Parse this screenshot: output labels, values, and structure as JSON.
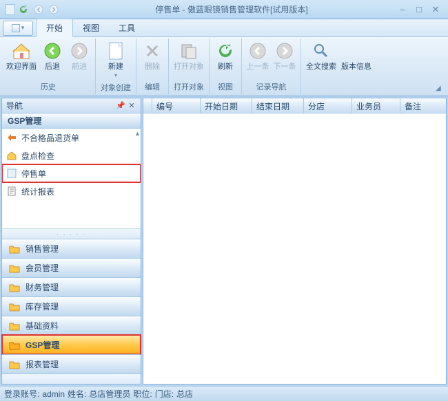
{
  "title": "停售单 - 傲蓝眼镜销售管理软件[试用版本]",
  "tabs": {
    "start": "开始",
    "view": "视图",
    "tools": "工具"
  },
  "ribbon": {
    "welcome": "欢迎界面",
    "back": "后退",
    "forward": "前进",
    "new": "新建",
    "delete": "删除",
    "openobj": "打开对象",
    "refresh": "刷新",
    "prev": "上一条",
    "next": "下一条",
    "search": "全文搜索",
    "version": "版本信息",
    "g_history": "历史",
    "g_create": "对象创建",
    "g_edit": "编辑",
    "g_open": "打开对象",
    "g_view": "视图",
    "g_nav": "记录导航"
  },
  "nav": {
    "title": "导航",
    "section": "GSP管理",
    "items": [
      "不合格品退货单",
      "盘点检查",
      "停售单",
      "统计报表"
    ],
    "cats": [
      "销售管理",
      "会员管理",
      "财务管理",
      "库存管理",
      "基础资料",
      "GSP管理",
      "报表管理"
    ]
  },
  "grid": {
    "cols": [
      "编号",
      "开始日期",
      "结束日期",
      "分店",
      "业务员",
      "备注"
    ]
  },
  "status": {
    "acct_label": "登录账号:",
    "acct": "admin",
    "name_label": "姓名:",
    "name": "总店管理员",
    "role_label": "职位:",
    "store_label": "门店:",
    "store": "总店"
  }
}
